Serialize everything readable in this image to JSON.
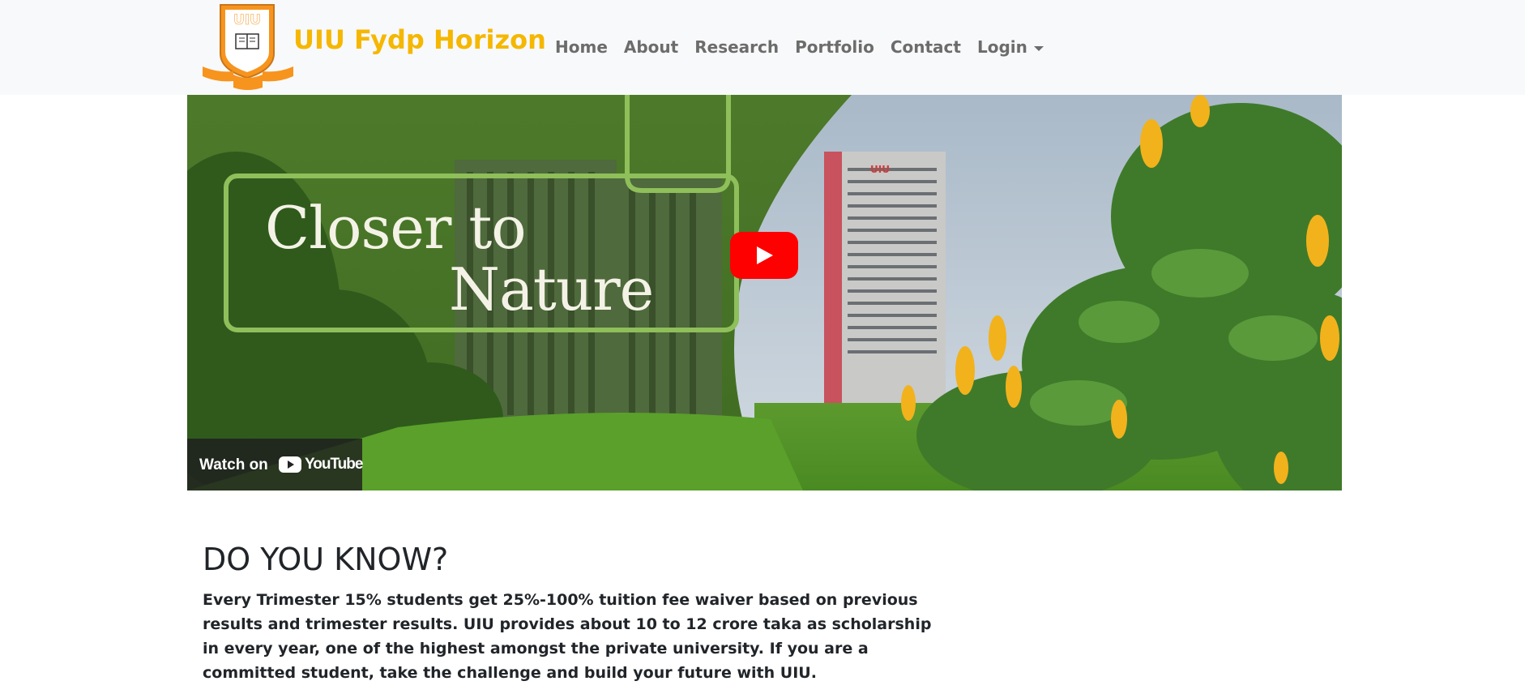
{
  "navbar": {
    "logo": {
      "icon": "uiu-crest-logo",
      "text": "UIU"
    },
    "brand": "UIU Fydp Horizon",
    "links": [
      "Home",
      "About",
      "Research",
      "Portfolio",
      "Contact"
    ],
    "login": "Login",
    "colors": {
      "background": "#f8f9fa",
      "brand": "#f5b700",
      "link": "#6c6c6c"
    }
  },
  "video": {
    "headline_line1": "Closer to",
    "headline_line2": "Nature",
    "building_sign": "UIU",
    "play_icon": "youtube-play-button",
    "watch_on": "Watch on",
    "youtube": "YouTube"
  },
  "info": {
    "title": "DO YOU KNOW?",
    "body": "Every Trimester 15% students get 25%-100% tuition fee waiver based on previous results and trimester results. UIU provides about 10 to 12 crore taka as scholarship in every year, one of the highest amongst the private university. If you are a committed student, take the challenge and build your future with UIU."
  }
}
